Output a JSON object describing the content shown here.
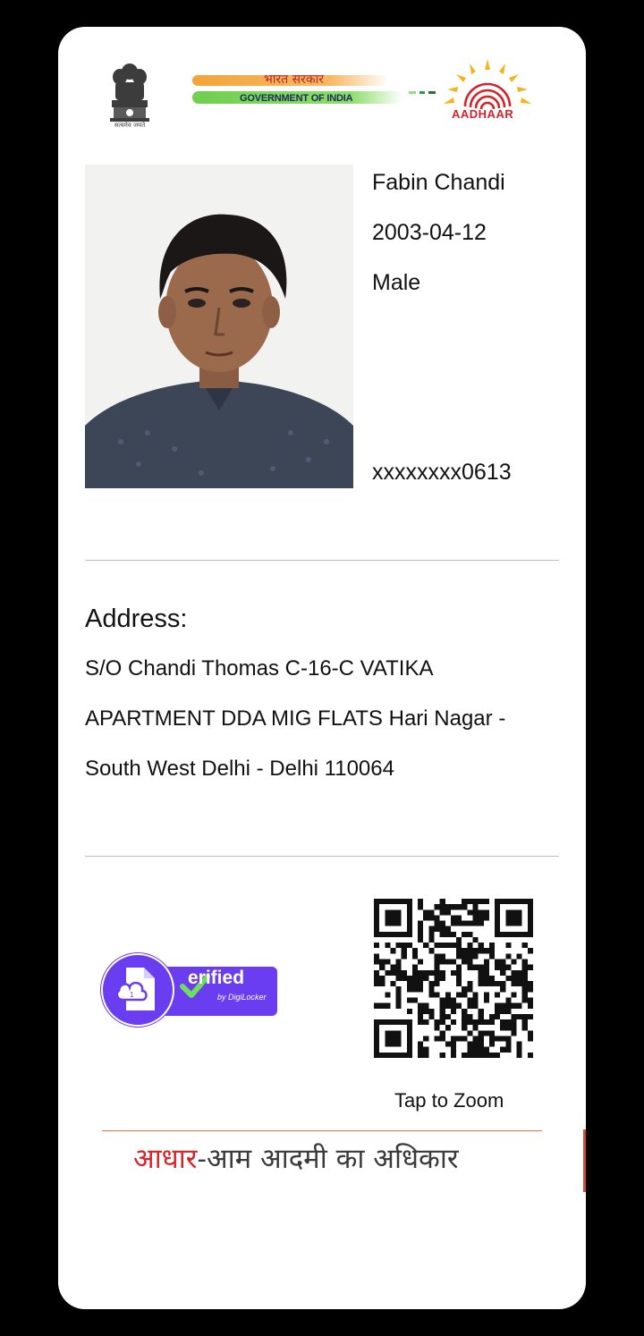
{
  "header": {
    "emblem_motto": "सत्यमेव जयते",
    "gov_hindi": "भारत सरकार",
    "gov_english": "GOVERNMENT OF INDIA",
    "aadhaar_label": "AADHAAR"
  },
  "profile": {
    "name": "Fabin Chandi",
    "dob": "2003-04-12",
    "gender": " Male",
    "aadhaar_masked": "xxxxxxxx0613"
  },
  "address": {
    "title": "Address:",
    "lines": [
      "S/O Chandi Thomas C-16-C VATIKA",
      "APARTMENT DDA MIG FLATS Hari Nagar -",
      "South West Delhi - Delhi 110064"
    ]
  },
  "badge": {
    "verified_text": "erified",
    "verified_sub": "by DigiLocker"
  },
  "qr": {
    "tap_to_zoom": "Tap to Zoom"
  },
  "footer": {
    "slogan_red": "आधार",
    "slogan_rest": "-आम आदमी का अधिकार"
  },
  "colors": {
    "background": "#000000",
    "card": "#ffffff",
    "aadhaar_red": "#d2232a",
    "digilocker_purple": "#6b3df0",
    "divider": "#bdbdbd"
  }
}
